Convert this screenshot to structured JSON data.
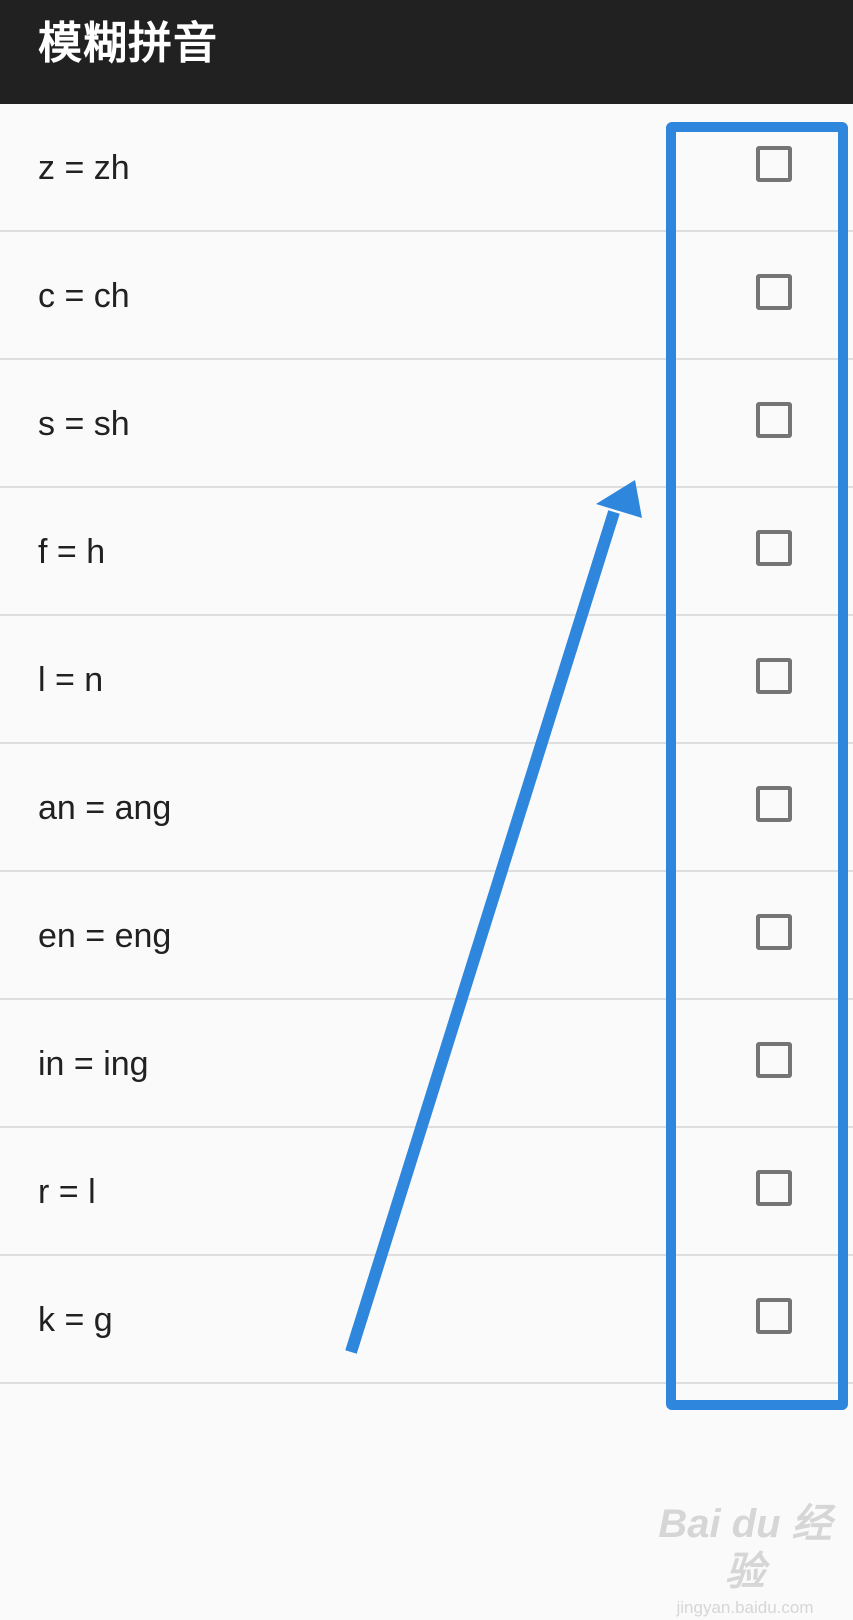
{
  "app_bar": {
    "title": "模糊拼音"
  },
  "options": [
    {
      "label": "z = zh",
      "checked": false
    },
    {
      "label": "c = ch",
      "checked": false
    },
    {
      "label": "s = sh",
      "checked": false
    },
    {
      "label": "f = h",
      "checked": false
    },
    {
      "label": "l = n",
      "checked": false
    },
    {
      "label": "an = ang",
      "checked": false
    },
    {
      "label": "en = eng",
      "checked": false
    },
    {
      "label": "in = ing",
      "checked": false
    },
    {
      "label": "r = l",
      "checked": false
    },
    {
      "label": "k = g",
      "checked": false
    }
  ],
  "annotation": {
    "color": "#2f86dd"
  },
  "watermark": {
    "logo": "Bai du 经验",
    "url": "jingyan.baidu.com"
  }
}
